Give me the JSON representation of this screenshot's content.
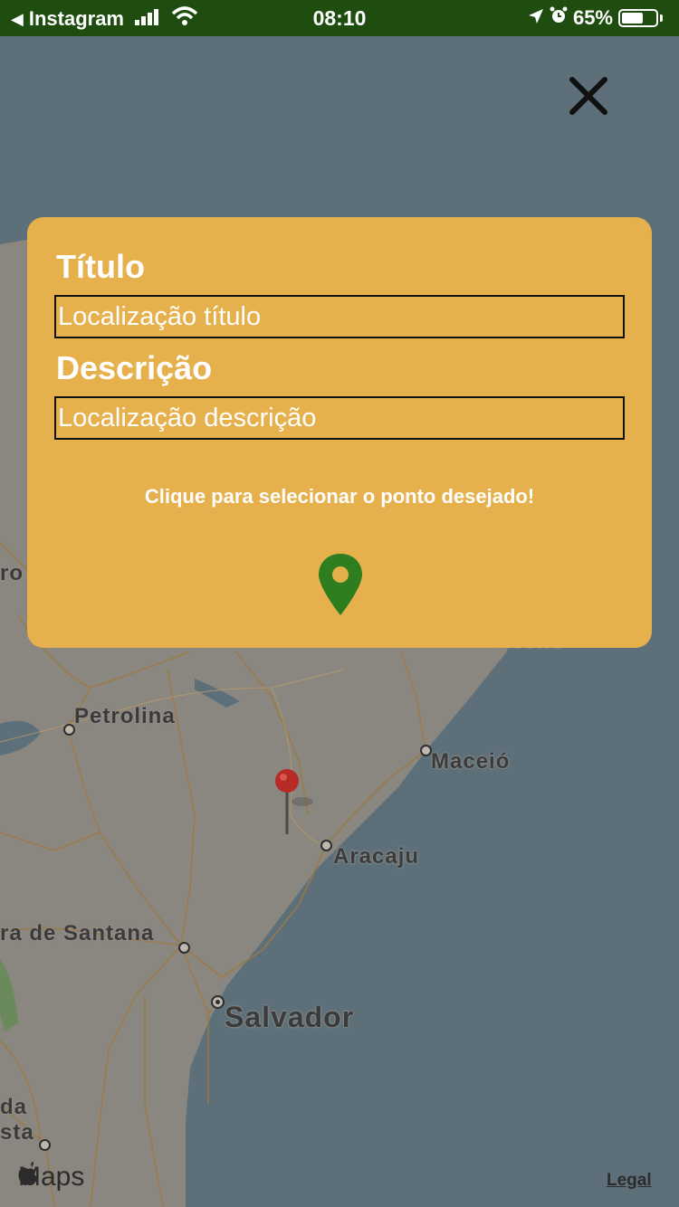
{
  "status_bar": {
    "back_app": "Instagram",
    "time": "08:10",
    "battery_percent": "65%",
    "battery_level": 0.65
  },
  "map": {
    "cities": [
      {
        "name": "Petrolina"
      },
      {
        "name": "Maceió"
      },
      {
        "name": "Aracaju"
      },
      {
        "name": "ra de Santana"
      },
      {
        "name": "Salvador"
      },
      {
        "name": "da"
      },
      {
        "name": "sta"
      },
      {
        "name": "ro"
      },
      {
        "name": "Recife"
      }
    ],
    "brand": "Maps",
    "legal_link": "Legal"
  },
  "modal": {
    "title_label": "Título",
    "title_placeholder": "Localização título",
    "description_label": "Descrição",
    "description_placeholder": "Localização descrição",
    "hint": "Clique para selecionar o ponto desejado!"
  },
  "colors": {
    "status_bar_bg": "#1f4d0f",
    "modal_bg": "#e6b04c",
    "pin_green": "#2e7d1e",
    "map_pin_red": "#b72a25",
    "water": "#5d707a",
    "land": "#8a8680"
  }
}
